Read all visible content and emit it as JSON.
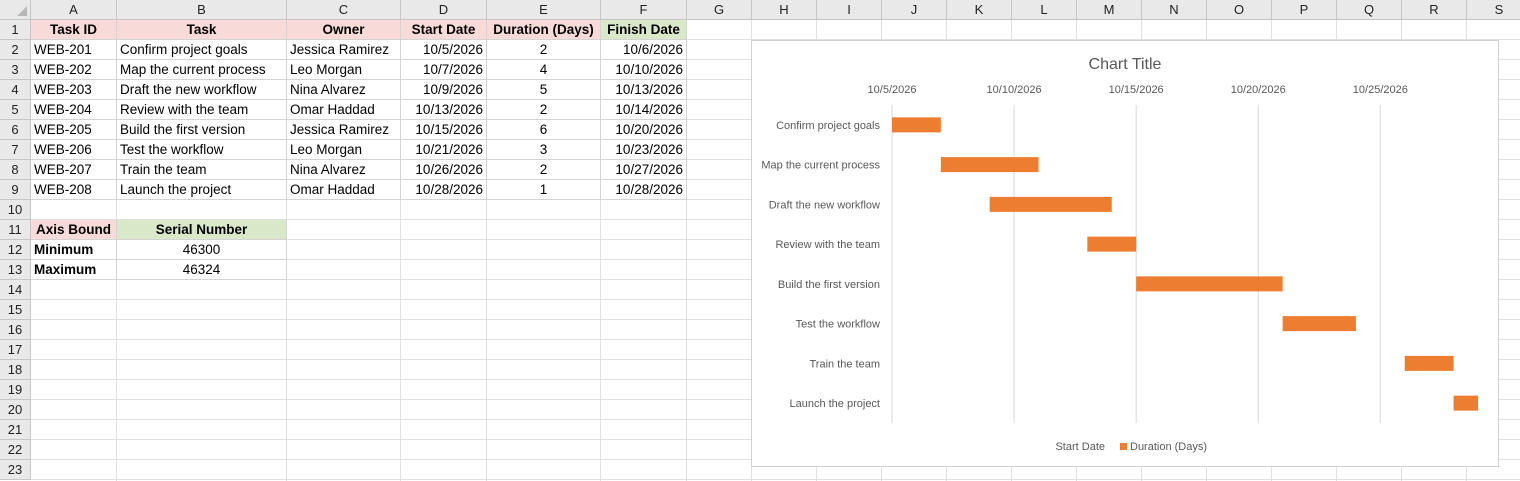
{
  "sheet": {
    "columns": [
      "A",
      "B",
      "C",
      "D",
      "E",
      "F",
      "G",
      "H",
      "I",
      "J",
      "K",
      "L",
      "M",
      "N",
      "O",
      "P",
      "Q",
      "R",
      "S"
    ],
    "rows": [
      "1",
      "2",
      "3",
      "4",
      "5",
      "6",
      "7",
      "8",
      "9",
      "10",
      "11",
      "12",
      "13",
      "14",
      "15",
      "16",
      "17",
      "18",
      "19",
      "20",
      "21",
      "22",
      "23"
    ]
  },
  "table": {
    "headers": {
      "task_id": "Task ID",
      "task": "Task",
      "owner": "Owner",
      "start": "Start Date",
      "duration": "Duration (Days)",
      "finish": "Finish Date"
    },
    "rows": [
      {
        "id": "WEB-201",
        "task": "Confirm project goals",
        "owner": "Jessica Ramirez",
        "start": "10/5/2026",
        "duration": "2",
        "finish": "10/6/2026"
      },
      {
        "id": "WEB-202",
        "task": "Map the current process",
        "owner": "Leo Morgan",
        "start": "10/7/2026",
        "duration": "4",
        "finish": "10/10/2026"
      },
      {
        "id": "WEB-203",
        "task": "Draft the new workflow",
        "owner": "Nina Alvarez",
        "start": "10/9/2026",
        "duration": "5",
        "finish": "10/13/2026"
      },
      {
        "id": "WEB-204",
        "task": "Review with the team",
        "owner": "Omar Haddad",
        "start": "10/13/2026",
        "duration": "2",
        "finish": "10/14/2026"
      },
      {
        "id": "WEB-205",
        "task": "Build the first version",
        "owner": "Jessica Ramirez",
        "start": "10/15/2026",
        "duration": "6",
        "finish": "10/20/2026"
      },
      {
        "id": "WEB-206",
        "task": "Test the workflow",
        "owner": "Leo Morgan",
        "start": "10/21/2026",
        "duration": "3",
        "finish": "10/23/2026"
      },
      {
        "id": "WEB-207",
        "task": "Train the team",
        "owner": "Nina Alvarez",
        "start": "10/26/2026",
        "duration": "2",
        "finish": "10/27/2026"
      },
      {
        "id": "WEB-208",
        "task": "Launch the project",
        "owner": "Omar Haddad",
        "start": "10/28/2026",
        "duration": "1",
        "finish": "10/28/2026"
      }
    ]
  },
  "bounds": {
    "header_label": "Axis Bound",
    "header_value": "Serial Number",
    "min_label": "Minimum",
    "min_value": "46300",
    "max_label": "Maximum",
    "max_value": "46324"
  },
  "colors": {
    "bar": "#ed7d31",
    "pink_header": "#f8dbd9",
    "green_header": "#d9e8c9"
  },
  "chart_data": {
    "type": "bar",
    "orientation": "horizontal-stacked",
    "title": "Chart Title",
    "categories": [
      "Confirm project goals",
      "Map the current process",
      "Draft the new workflow",
      "Review with the team",
      "Build the first version",
      "Test the workflow",
      "Train the team",
      "Launch the project"
    ],
    "series": [
      {
        "name": "Start Date",
        "visible": false,
        "values": [
          "2026-10-05",
          "2026-10-07",
          "2026-10-09",
          "2026-10-13",
          "2026-10-15",
          "2026-10-21",
          "2026-10-26",
          "2026-10-28"
        ]
      },
      {
        "name": "Duration (Days)",
        "values": [
          2,
          4,
          5,
          2,
          6,
          3,
          2,
          1
        ]
      }
    ],
    "xlim": [
      "2026-10-05",
      "2026-10-29"
    ],
    "x_ticks": [
      "10/5/2026",
      "10/10/2026",
      "10/15/2026",
      "10/20/2026",
      "10/25/2026"
    ],
    "x_axis_position": "top",
    "grid": true,
    "legend": "bottom"
  }
}
